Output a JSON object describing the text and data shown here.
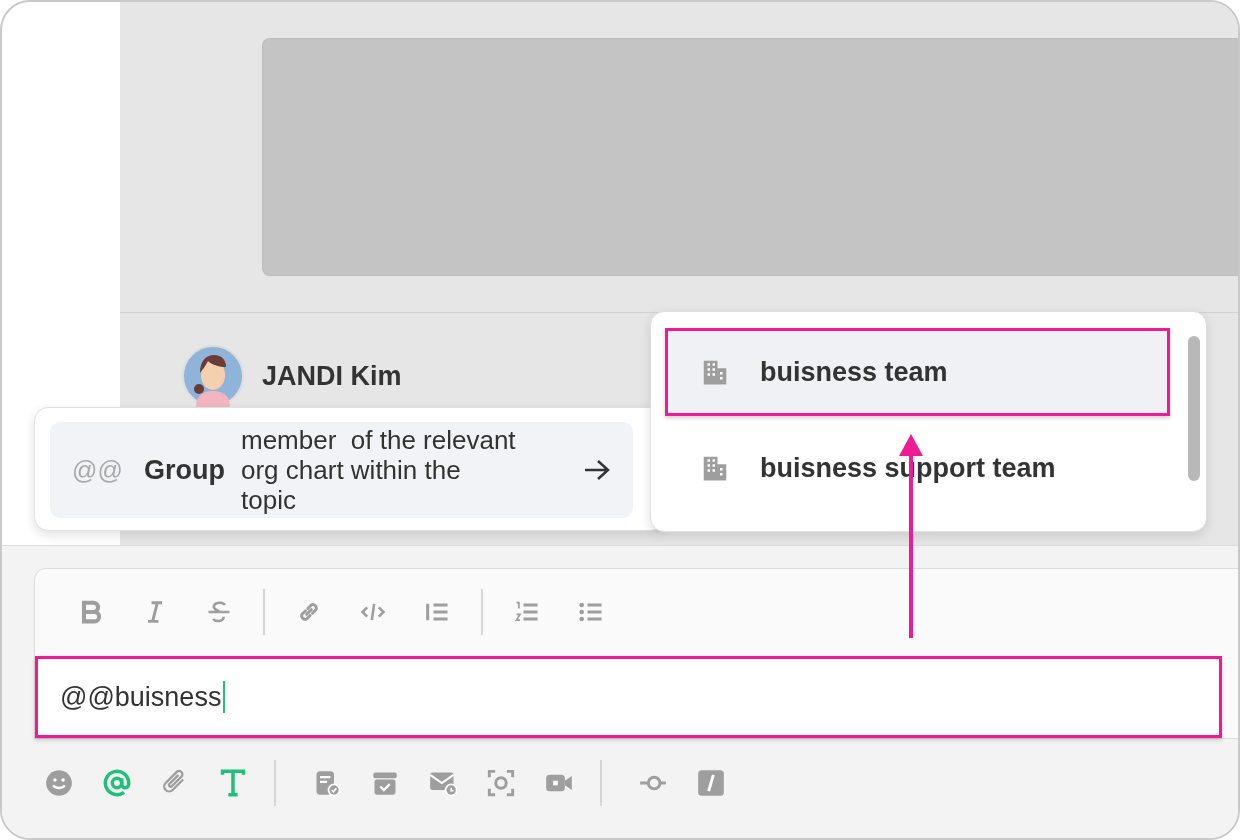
{
  "message": {
    "author": "JANDI Kim"
  },
  "group_option": {
    "prefix": "@@",
    "label": "Group",
    "description": "member  of the relevant org chart within the topic"
  },
  "suggestions": [
    {
      "name": "buisness team",
      "selected": true
    },
    {
      "name": "buisness support team",
      "selected": false
    }
  ],
  "composer": {
    "value": "@@buisness"
  }
}
